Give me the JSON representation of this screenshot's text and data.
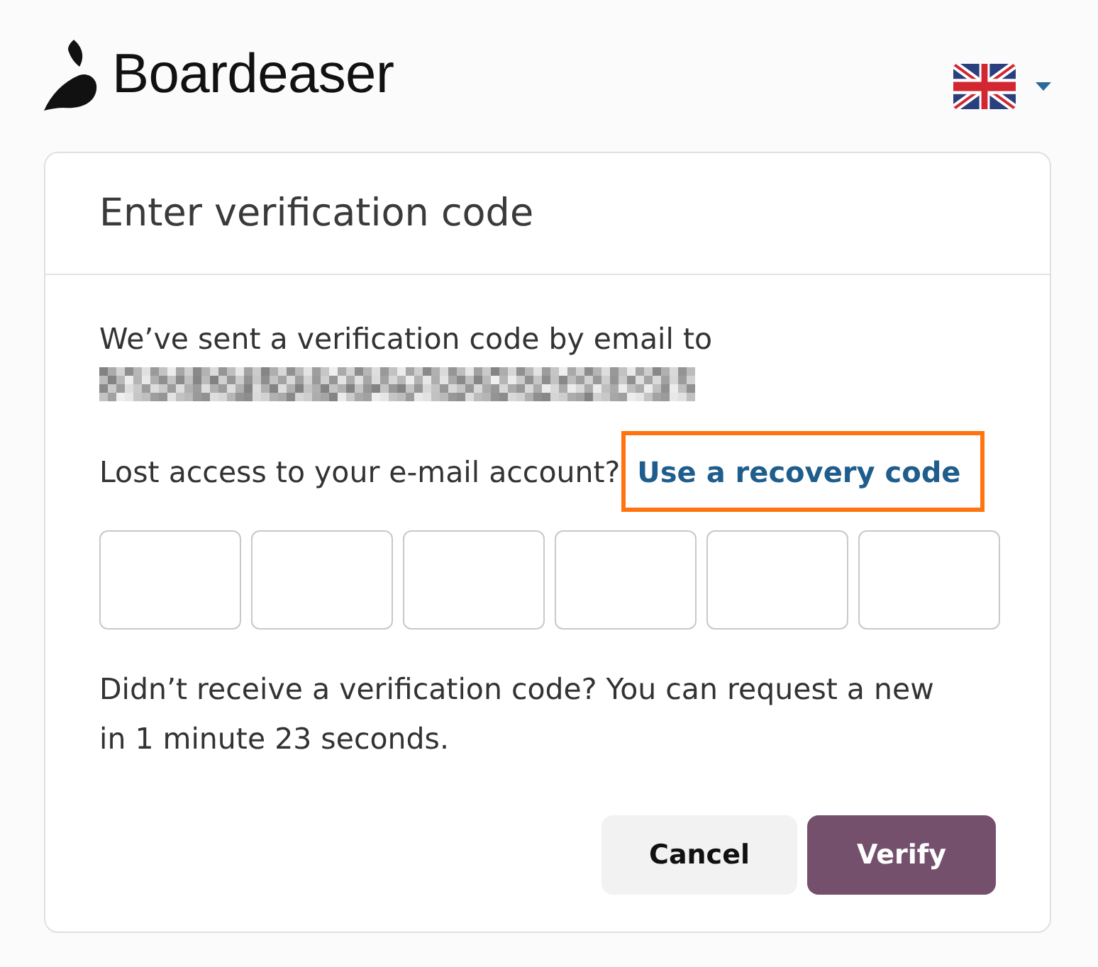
{
  "brand": {
    "name": "Boardeaser"
  },
  "dialog": {
    "title": "Enter verification code",
    "message": "We’ve sent a verification code by email to",
    "email": {
      "redacted": true
    },
    "recovery": {
      "prompt": "Lost access to your e-mail account?",
      "link": "Use a recovery code",
      "highlighted": true
    },
    "code_fields": [
      {
        "kind": "digit"
      },
      {
        "kind": "digit"
      },
      {
        "kind": "digit"
      },
      {
        "kind": "digit"
      },
      {
        "kind": "digit"
      },
      {
        "kind": "digit"
      }
    ],
    "resend_notice": "Didn’t receive a verification code? You can request a new in 1 minute 23 seconds.",
    "buttons": [
      {
        "label": "Cancel",
        "kind": "secondary"
      },
      {
        "label": "Verify",
        "kind": "primary"
      }
    ]
  }
}
